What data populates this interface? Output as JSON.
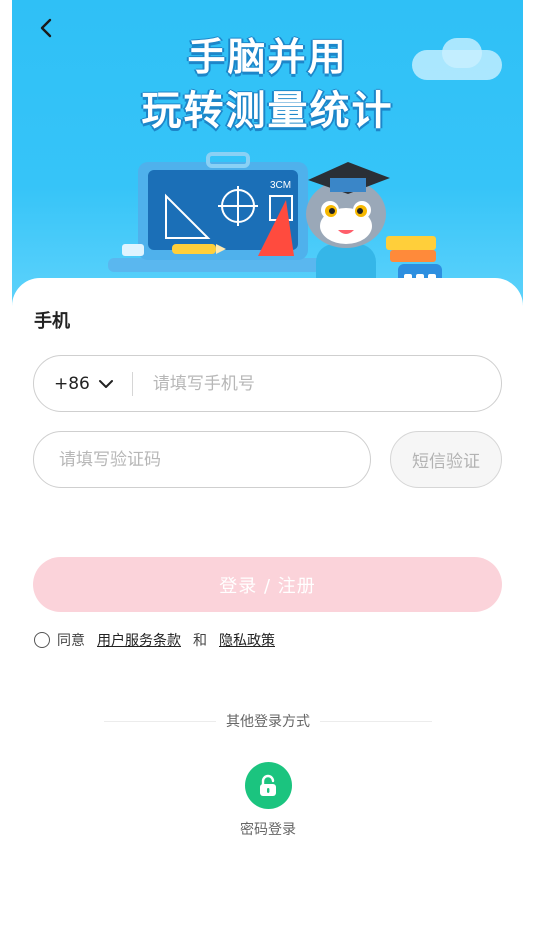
{
  "banner": {
    "headline_line1": "手脑并用",
    "headline_line2": "玩转测量统计",
    "board_label": "3CM",
    "back_icon": "chevron-left-icon"
  },
  "form": {
    "section_title": "手机",
    "country_code": "+86",
    "phone_placeholder": "请填写手机号",
    "code_placeholder": "请填写验证码",
    "sms_button": "短信验证",
    "login_button": "登录 / 注册"
  },
  "agreement": {
    "prefix": "同意",
    "terms_link": "用户服务条款",
    "and": "和",
    "privacy_link": "隐私政策"
  },
  "other_login": {
    "title": "其他登录方式",
    "password_login_label": "密码登录",
    "password_icon": "unlock-icon",
    "accent": "#1bc47f"
  },
  "colors": {
    "banner": "#2fc0f6",
    "login_button_disabled": "#fbd3da"
  }
}
